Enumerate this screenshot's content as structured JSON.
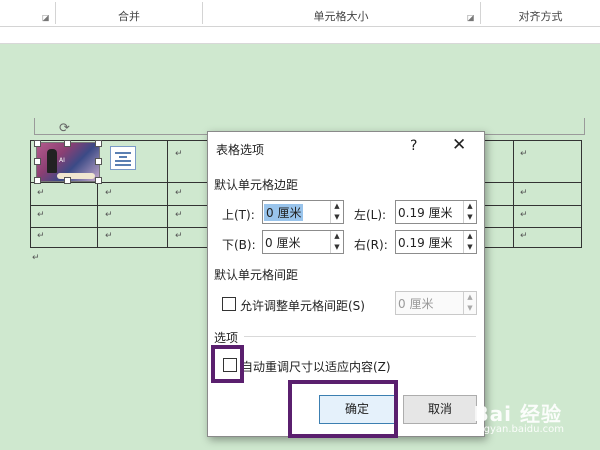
{
  "ribbon": {
    "groups": [
      "合并",
      "单元格大小",
      "对齐方式"
    ]
  },
  "document": {
    "cell_mark": "↵",
    "image_tag": "AI",
    "rotate_glyph": "⟳"
  },
  "dialog": {
    "title": "表格选项",
    "help": "?",
    "close": "✕",
    "margins_section": "默认单元格边距",
    "top_label": "上(T):",
    "top_value": "0 厘米",
    "left_label": "左(L):",
    "left_value": "0.19 厘米",
    "bottom_label": "下(B):",
    "bottom_value": "0 厘米",
    "right_label": "右(R):",
    "right_value": "0.19 厘米",
    "spacing_section": "默认单元格间距",
    "allow_spacing_label": "允许调整单元格间距(S)",
    "allow_spacing_checked": false,
    "spacing_value": "0 厘米",
    "options_section": "选项",
    "autofit_label": "自动重调尺寸以适应内容(Z)",
    "autofit_checked": false,
    "ok_label": "确定",
    "cancel_label": "取消"
  },
  "watermark": {
    "brand": "Bai 经验",
    "url": "jingyan.baidu.com"
  },
  "colors": {
    "doc_background": "#cfe8cf",
    "highlight": "#5a1f6e",
    "selection": "#99c4ec"
  },
  "icons": [
    "dialog-launcher-icon",
    "rotate-handle-icon",
    "layout-options-icon",
    "paragraph-mark-icon",
    "close-icon",
    "help-icon",
    "spin-up-icon",
    "spin-down-icon"
  ]
}
